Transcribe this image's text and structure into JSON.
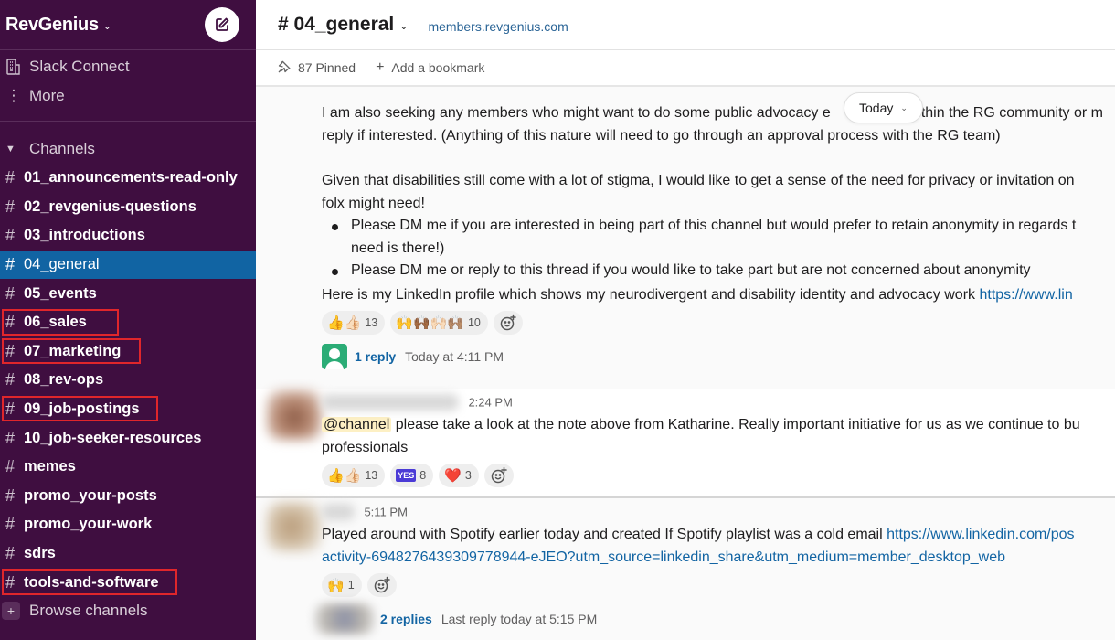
{
  "workspace": {
    "name": "RevGenius",
    "compose_icon": "compose-icon"
  },
  "sidebar": {
    "nav": [
      {
        "label": "Slack Connect",
        "icon": "building-icon"
      },
      {
        "label": "More",
        "icon": "more-vertical-icon"
      }
    ],
    "channels_header": "Channels",
    "channels": [
      {
        "name": "01_announcements-read-only",
        "active": false,
        "highlighted": false
      },
      {
        "name": "02_revgenius-questions",
        "active": false,
        "highlighted": false
      },
      {
        "name": "03_introductions",
        "active": false,
        "highlighted": false
      },
      {
        "name": "04_general",
        "active": true,
        "highlighted": false
      },
      {
        "name": "05_events",
        "active": false,
        "highlighted": false
      },
      {
        "name": "06_sales",
        "active": false,
        "highlighted": true
      },
      {
        "name": "07_marketing",
        "active": false,
        "highlighted": true
      },
      {
        "name": "08_rev-ops",
        "active": false,
        "highlighted": false
      },
      {
        "name": "09_job-postings",
        "active": false,
        "highlighted": true
      },
      {
        "name": "10_job-seeker-resources",
        "active": false,
        "highlighted": false
      },
      {
        "name": "memes",
        "active": false,
        "highlighted": false
      },
      {
        "name": "promo_your-posts",
        "active": false,
        "highlighted": false
      },
      {
        "name": "promo_your-work",
        "active": false,
        "highlighted": false
      },
      {
        "name": "sdrs",
        "active": false,
        "highlighted": false
      },
      {
        "name": "tools-and-software",
        "active": false,
        "highlighted": true
      }
    ],
    "browse_label": "Browse channels"
  },
  "header": {
    "channel_title": "# 04_general",
    "topic": "members.revgenius.com",
    "pinned_label": "87 Pinned",
    "add_bookmark_label": "Add a bookmark"
  },
  "date_divider": {
    "label": "Today"
  },
  "messages": [
    {
      "lines": {
        "p1a": "I am also seeking any members who might want to do some public advocacy e",
        "p1b": "within the RG community or m",
        "p1c": "reply if interested. (Anything of this nature will need to go through an approval process with the RG team)",
        "p2a": "Given that disabilities still come with a lot of stigma, I would like to get a sense of the need for privacy or invitation on",
        "p2b": "folx might need!",
        "b1a": "Please DM me if you are interested in being part of this channel but would prefer to retain anonymity in regards t",
        "b1b": "need is there!)",
        "b2": "Please DM me or reply to this thread if you would like to take part but are not concerned about anonymity",
        "p3": "Here is my LinkedIn profile which shows my neurodivergent and disability identity and advocacy work ",
        "p3_link": "https://www.lin"
      },
      "reactions": [
        {
          "emoji": "👍👍🏻",
          "count": "13"
        },
        {
          "emoji": "🙌🙌🏾🙌🏻🙌🏽",
          "count": "10"
        }
      ],
      "thread": {
        "replies": "1 reply",
        "meta": "Today at 4:11 PM"
      }
    },
    {
      "time": "2:24 PM",
      "mention": "@channel",
      "text_a": " please take a look at the note above from Katharine. Really important initiative for us as we continue to bu",
      "text_b": "professionals",
      "reactions": [
        {
          "emoji": "👍👍🏻",
          "count": "13"
        },
        {
          "badge": "YES",
          "count": "8"
        },
        {
          "emoji": "❤️",
          "count": "3"
        }
      ]
    },
    {
      "time": "5:11 PM",
      "text": "Played around with Spotify earlier today and created If Spotify playlist was a cold email  ",
      "link_a": "https://www.linkedin.com/pos",
      "link_b": "activity-6948276439309778944-eJEO?utm_source=linkedin_share&utm_medium=member_desktop_web",
      "reactions": [
        {
          "emoji": "🙌",
          "count": "1"
        }
      ],
      "thread": {
        "replies": "2 replies",
        "meta": "Last reply today at 5:15 PM"
      }
    }
  ],
  "colors": {
    "sidebar_bg": "#3f0e40",
    "active_channel": "#1164a3",
    "highlight_box": "#e0262b",
    "link": "#1264a3"
  }
}
